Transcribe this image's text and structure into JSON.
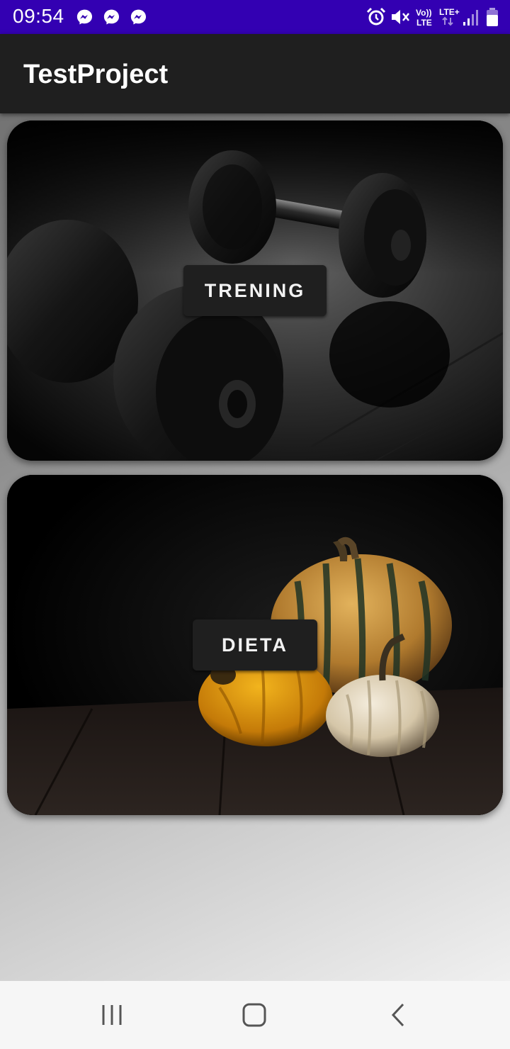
{
  "status_bar": {
    "time": "09:54",
    "notifications": [
      "messenger-icon",
      "messenger-icon",
      "messenger-icon"
    ],
    "volte_label_top": "Vo))",
    "volte_label_bottom": "LTE",
    "network_label": "LTE+",
    "icons": [
      "alarm-icon",
      "mute-icon",
      "volte-icon",
      "lte-plus-icon",
      "signal-icon",
      "battery-icon"
    ],
    "background_color": "#3300b2"
  },
  "app_bar": {
    "title": "TestProject",
    "background_color": "#1f1f1f"
  },
  "cards": [
    {
      "id": "training",
      "button_label": "TRENING",
      "image": "dumbbells-photo"
    },
    {
      "id": "diet",
      "button_label": "DIETA",
      "image": "pumpkins-photo"
    }
  ],
  "nav_bar": {
    "buttons": [
      "recent-apps-icon",
      "home-icon",
      "back-icon"
    ]
  }
}
